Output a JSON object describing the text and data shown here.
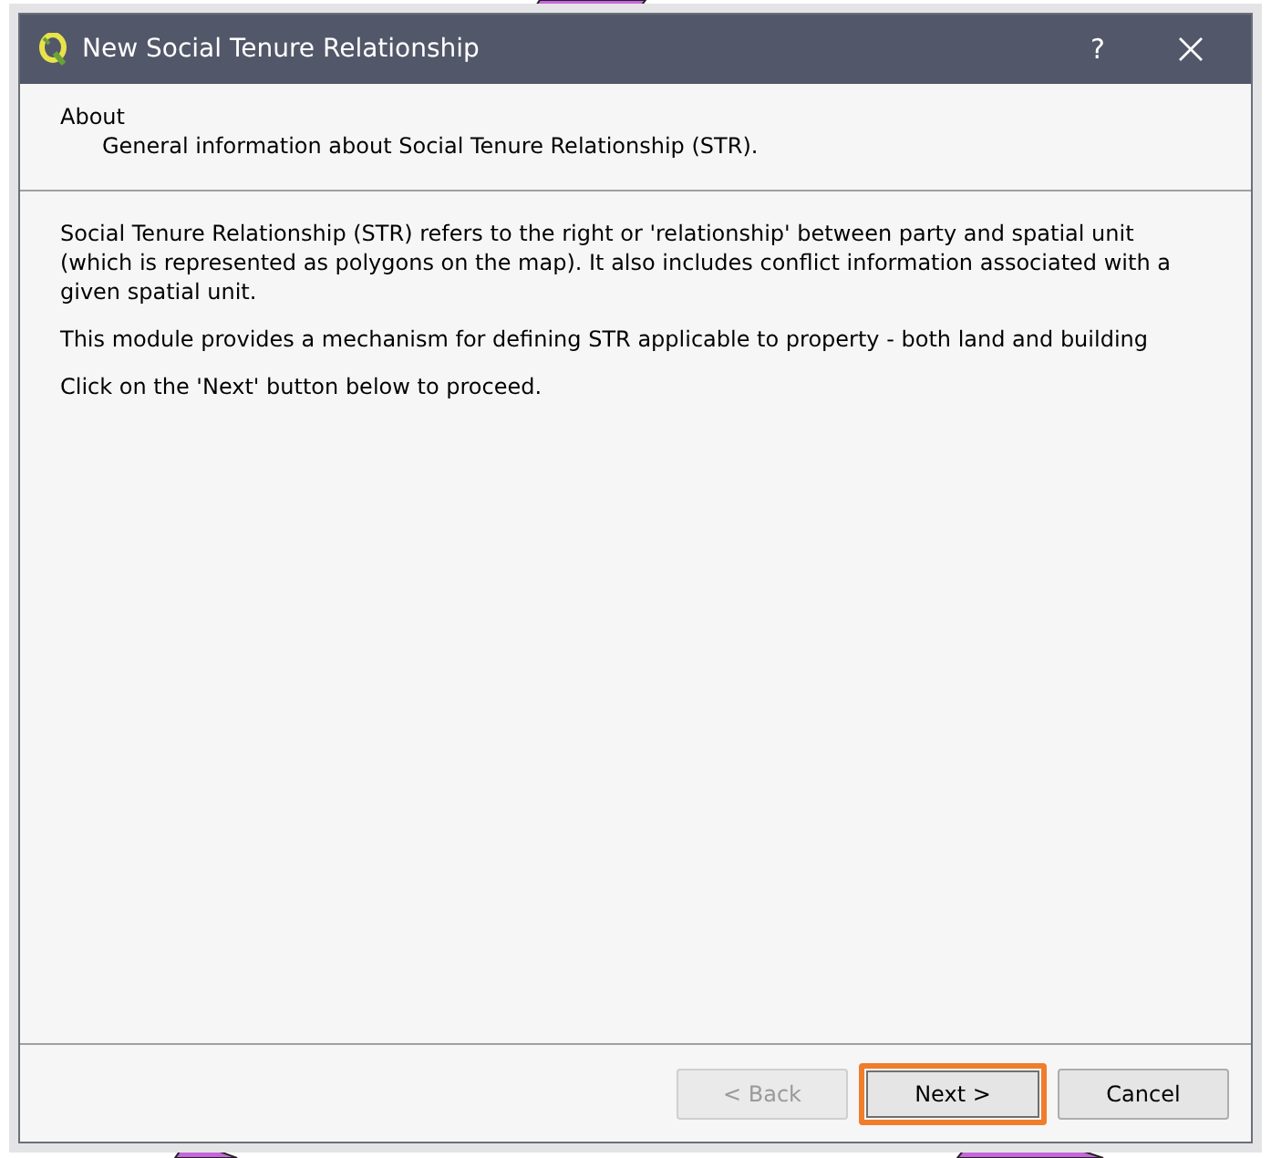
{
  "window": {
    "title": "New Social Tenure Relationship",
    "help": "?"
  },
  "header": {
    "title": "About",
    "subtitle": "General information about Social Tenure Relationship (STR)."
  },
  "paragraphs": [
    "Social Tenure Relationship (STR) refers to the right or 'relationship' between party and spatial unit (which is represented as polygons on the map). It also includes conflict information associated with a given spatial unit.",
    "This module provides a mechanism for defining STR applicable to property - both land and building",
    "Click on the 'Next' button below to proceed."
  ],
  "buttons": [
    {
      "label": "< Back",
      "disabled": true,
      "focused": false
    },
    {
      "label": "Next >",
      "disabled": false,
      "focused": true
    },
    {
      "label": "Cancel",
      "disabled": false,
      "focused": false
    }
  ]
}
